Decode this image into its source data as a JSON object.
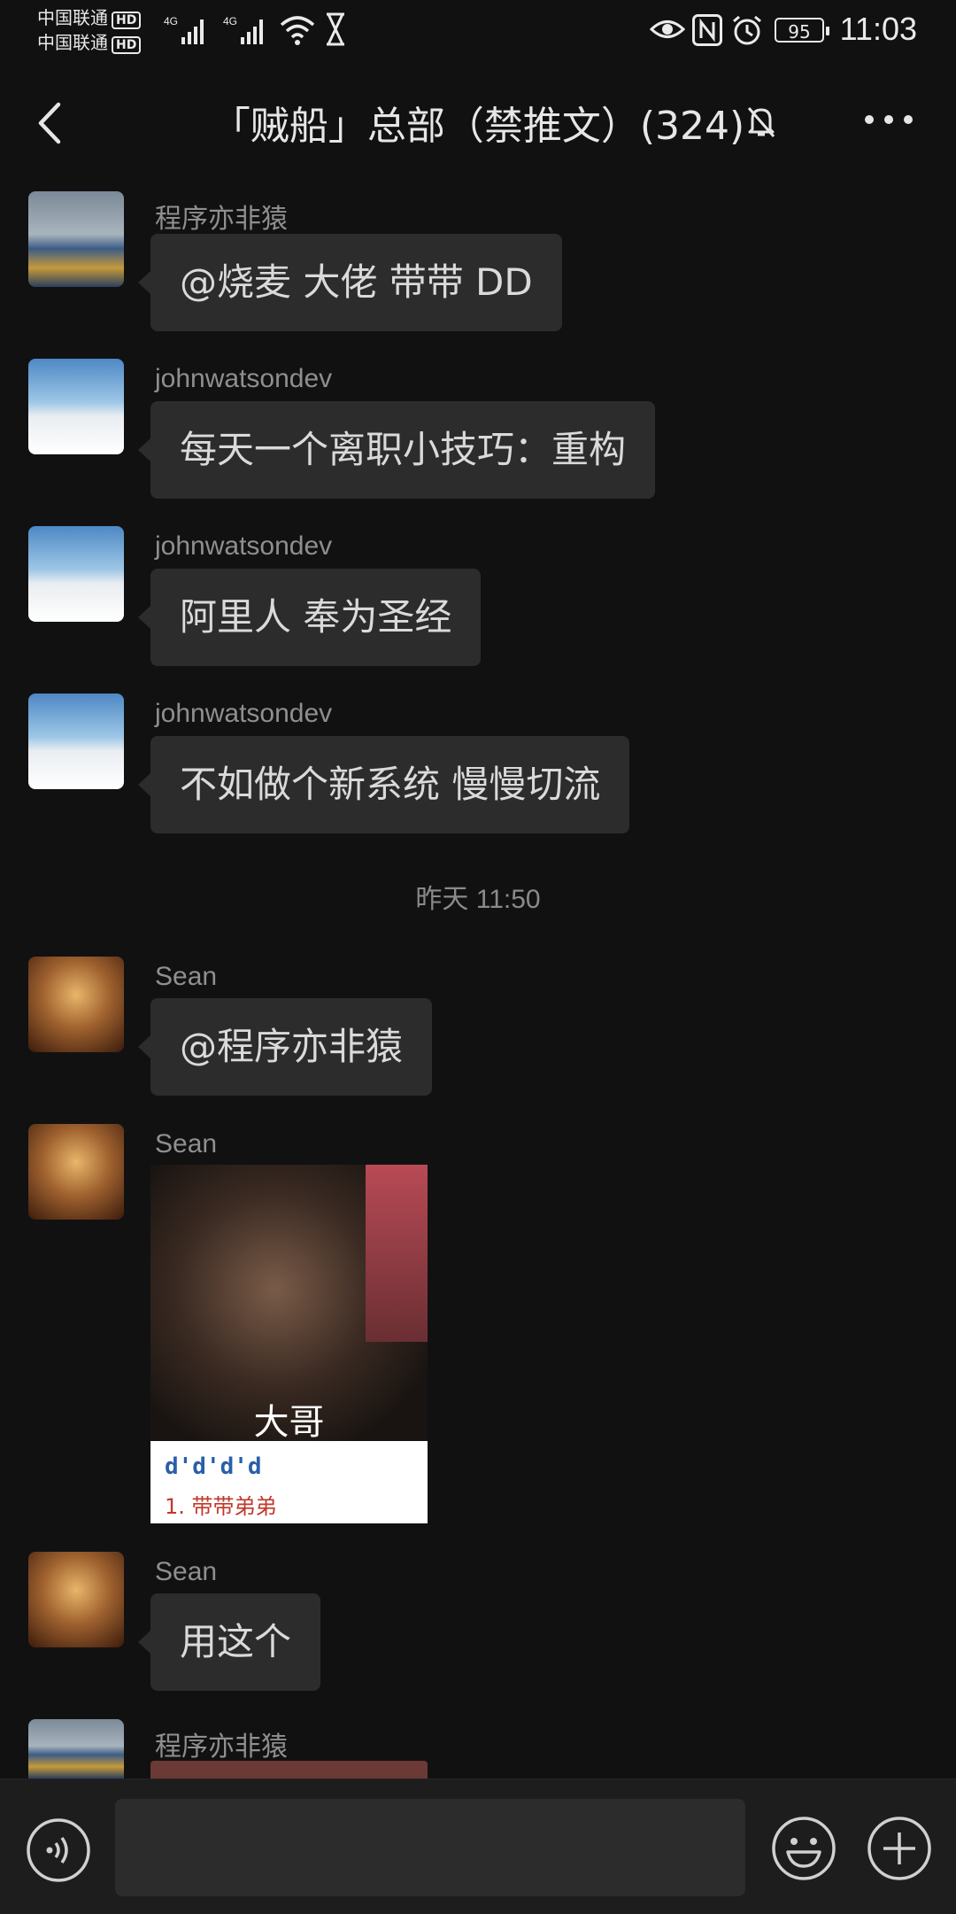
{
  "status": {
    "carrier1": "中国联通",
    "carrier2": "中国联通",
    "hd": "HD",
    "net1": "4G",
    "net2": "4G",
    "battery": "95",
    "time": "11:03"
  },
  "header": {
    "title": "「贼船」总部（禁推文）(324)"
  },
  "messages": [
    {
      "sender": "程序亦非猿",
      "text": "@烧麦  大佬 带带 DD"
    },
    {
      "sender": "johnwatsondev",
      "text": "每天一个离职小技巧：重构"
    },
    {
      "sender": "johnwatsondev",
      "text": "阿里人 奉为圣经"
    },
    {
      "sender": "johnwatsondev",
      "text": "不如做个新系统 慢慢切流"
    },
    {
      "sender": "Sean",
      "text": "@程序亦非猿"
    },
    {
      "sender": "Sean",
      "sticker_caption": "大哥",
      "sticker_line1": "d'd'd'd",
      "sticker_line2": "1. 带带弟弟"
    },
    {
      "sender": "Sean",
      "text": "用这个"
    },
    {
      "sender": "程序亦非猿"
    }
  ],
  "timestamp": "昨天 11:50",
  "input": {
    "value": ""
  },
  "colors": {
    "background": "#111111",
    "bubble": "#2c2c2c",
    "text": "#dadada",
    "name": "#8f8f8f"
  }
}
